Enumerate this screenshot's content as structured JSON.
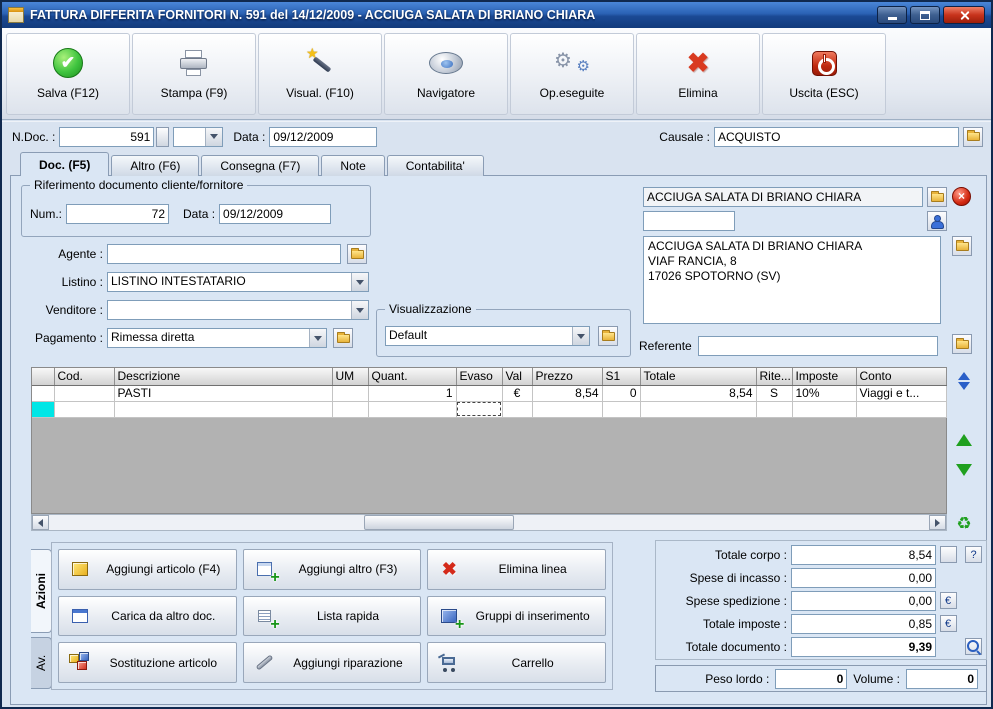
{
  "colors": {
    "titlebar_blue": "#1d4e96",
    "close_red": "#c8331c",
    "selection_cyan": "#00e6e6",
    "content_bg": "#dae6f4",
    "grid_empty_gray": "#b2b2b2",
    "field_border": "#7f9db9"
  },
  "window": {
    "title": "FATTURA DIFFERITA FORNITORI N. 591 del 14/12/2009 - ACCIUGA SALATA DI BRIANO CHIARA"
  },
  "toolbar": {
    "buttons": [
      "Salva (F12)",
      "Stampa (F9)",
      "Visual. (F10)",
      "Navigatore",
      "Op.eseguite",
      "Elimina",
      "Uscita (ESC)"
    ]
  },
  "doc_header": {
    "ndoc_label": "N.Doc. :",
    "ndoc_value": "591",
    "tipo_value": "",
    "data_label": "Data :",
    "data_value": "09/12/2009",
    "causale_label": "Causale :",
    "causale_value": "ACQUISTO"
  },
  "tabs": [
    "Doc. (F5)",
    "Altro (F6)",
    "Consegna (F7)",
    "Note",
    "Contabilita'"
  ],
  "form": {
    "riferimento_group": "Riferimento documento cliente/fornitore",
    "num_label": "Num.:",
    "num_value": "72",
    "rif_data_label": "Data :",
    "rif_data_value": "09/12/2009",
    "agente_label": "Agente :",
    "agente_value": "",
    "listino_label": "Listino :",
    "listino_value": "LISTINO INTESTATARIO",
    "venditore_label": "Venditore :",
    "venditore_value": "",
    "pagamento_label": "Pagamento :",
    "pagamento_value": "Rimessa diretta",
    "visualizzazione_group": "Visualizzazione",
    "visualizzazione_value": "Default"
  },
  "customer": {
    "name": "ACCIUGA SALATA DI BRIANO CHIARA",
    "code_value": "",
    "address": "ACCIUGA SALATA DI BRIANO CHIARA\nVIAF RANCIA, 8\n17026 SPOTORNO (SV)",
    "referente_label": "Referente",
    "referente_value": ""
  },
  "grid": {
    "columns": [
      "Cod.",
      "Descrizione",
      "UM",
      "Quant.",
      "Evaso",
      "Val",
      "Prezzo",
      "S1",
      "Totale",
      "Rite...",
      "Imposte",
      "Conto"
    ],
    "rows": [
      [
        "",
        "PASTI",
        "",
        "1",
        "",
        "€",
        "8,54",
        "0",
        "8,54",
        "S",
        "10%",
        "Viaggi e t..."
      ],
      [
        "",
        "",
        "",
        "",
        "",
        "",
        "",
        "",
        "",
        "",
        "",
        ""
      ]
    ]
  },
  "actions": {
    "tab_azioni": "Azioni",
    "tab_av": "Av.",
    "buttons": [
      "Aggiungi articolo (F4)",
      "Aggiungi altro (F3)",
      "Elimina linea",
      "Carica da altro doc.",
      "Lista rapida",
      "Gruppi di inserimento",
      "Sostituzione articolo",
      "Aggiungi riparazione",
      "Carrello"
    ]
  },
  "totals": {
    "corpo_label": "Totale corpo :",
    "corpo_value": "8,54",
    "incasso_label": "Spese di incasso :",
    "incasso_value": "0,00",
    "spedizione_label": "Spese spedizione :",
    "spedizione_value": "0,00",
    "imposte_label": "Totale imposte :",
    "imposte_value": "0,85",
    "documento_label": "Totale documento :",
    "documento_value": "9,39",
    "help_button": "?",
    "euro": "€",
    "peso_label": "Peso lordo :",
    "peso_value": "0",
    "volume_label": "Volume :",
    "volume_value": "0"
  }
}
